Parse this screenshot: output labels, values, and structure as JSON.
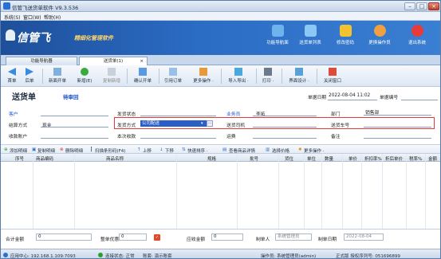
{
  "window": {
    "title": "信管飞送货单软件 V9.3.536"
  },
  "menu": [
    "系统(S)",
    "窗口(W)",
    "帮助(H)"
  ],
  "banner": {
    "brand": "信管飞",
    "slogan": "精细化管理软件",
    "buttons": [
      {
        "label": "功能导航面",
        "icon": "monitor-icon",
        "color": "#6fb3ee"
      },
      {
        "label": "送货单列表",
        "icon": "list-icon",
        "color": "#8cc8f5"
      },
      {
        "label": "修改密码",
        "icon": "lock-icon",
        "color": "#f2c230"
      },
      {
        "label": "更换操作员",
        "icon": "user-icon",
        "color": "#f0a040"
      },
      {
        "label": "退出系统",
        "icon": "exit-icon",
        "color": "#e83a3a"
      }
    ]
  },
  "tabs": [
    {
      "label": "功能导航器"
    },
    {
      "label": "送货单(1)",
      "close": "×"
    }
  ],
  "toolbar": [
    {
      "label": "首单",
      "icon": "first-icon"
    },
    {
      "label": "后单",
      "icon": "next-icon"
    },
    {
      "label": "新面开单",
      "icon": "new-page-icon"
    },
    {
      "label": "新增(E)",
      "icon": "add-icon"
    },
    {
      "label": "复制新增",
      "icon": "copy-icon"
    },
    {
      "label": "确认开单",
      "icon": "confirm-icon"
    },
    {
      "label": "引用订单",
      "icon": "reference-icon"
    },
    {
      "label": "更多操作 ·",
      "icon": "more-icon"
    },
    {
      "label": "导入导出 ·",
      "icon": "import-export-icon"
    },
    {
      "label": "打印 ·",
      "icon": "print-icon"
    },
    {
      "label": "界面设计 ·",
      "icon": "design-icon"
    },
    {
      "label": "关闭窗口",
      "icon": "close-window-icon"
    }
  ],
  "form": {
    "title": "送货单",
    "status": "待审回",
    "order_date_label": "单据日期",
    "order_date": "2022-08-04 11:02",
    "order_no_label": "单据编号",
    "fields": {
      "customer_label": "客户",
      "settle_label": "结算方式",
      "settle_value": "现金",
      "account_label": "收款账户",
      "ship_status_label": "发货状态",
      "ship_method_label": "发货方式",
      "ship_method_value": "公司配送",
      "ship_method_btn": "···",
      "this_receive_label": "本次收款",
      "salesman_label": "业务员",
      "salesman_value": "李拓",
      "driver_label": "送货司机",
      "freight_label": "运费",
      "dept_label": "部门",
      "dept_value": "销售部",
      "vehicle_label": "送货车号",
      "remark_label": "备注"
    }
  },
  "grid_toolbar": [
    "添加明细",
    "复制明细",
    "删除明细",
    "扫描条形码(F4)",
    "上移",
    "下移",
    "快速排序 ·",
    "查看商品详情",
    "选择价格",
    "更多操作 ·"
  ],
  "grid_headers": [
    "序号",
    "商品编码",
    "商品名称",
    "规格",
    "批号",
    "货位",
    "单位",
    "数量",
    "单价",
    "折扣率%",
    "折后单价",
    "税率%",
    "金额"
  ],
  "footer": {
    "total_label": "合计金额",
    "total_value": "0",
    "discount_label": "整单优惠",
    "discount_value": "0",
    "receivable_label": "应收金额",
    "receivable_value": "0",
    "maker_label": "制单人",
    "maker_value": "系统管理员",
    "make_date_label": "制单日期",
    "make_date_value": "2022-08-04"
  },
  "status": {
    "app_center": "应用中心: 192.168.1.109:7093",
    "conn": "连接状态: 正常",
    "book": "账套: 演示账套",
    "operator": "操作员: 系统管理员(admin)",
    "license": "正式版 授权序列号: 051696899"
  },
  "colors": {
    "accent": "#2b6cc4",
    "highlight": "#e03a3a",
    "link": "#1a4fd0"
  }
}
